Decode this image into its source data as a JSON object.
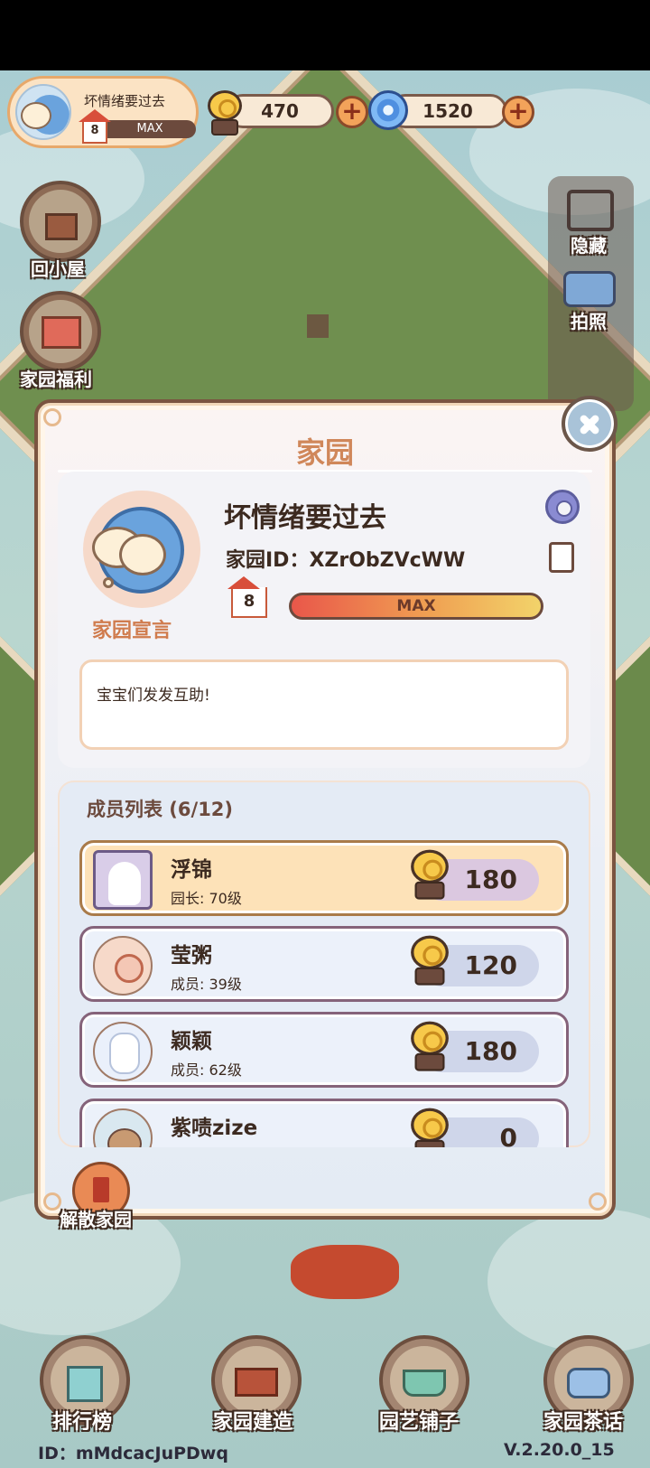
{
  "hud": {
    "garden_name": "坏情绪要过去",
    "level": "8",
    "level_state": "MAX",
    "snail_coins": "470",
    "orbs": "1520"
  },
  "side_left": [
    {
      "label": "回小屋"
    },
    {
      "label": "家园福利"
    }
  ],
  "side_right": [
    {
      "label": "隐藏"
    },
    {
      "label": "拍照"
    }
  ],
  "dialog": {
    "title": "家园",
    "garden_name": "坏情绪要过去",
    "garden_id": "家园ID：XZrObZVcWW",
    "level": "8",
    "level_state": "MAX",
    "declaration_label": "家园宣言",
    "declaration_text": "宝宝们发发互助!",
    "members_title": "成员列表 (6/12)",
    "members": [
      {
        "name": "浮锦",
        "role": "园长: 70级",
        "score": "180",
        "leader": true
      },
      {
        "name": "莹粥",
        "role": "成员: 39级",
        "score": "120",
        "leader": false
      },
      {
        "name": "颖颖",
        "role": "成员: 62级",
        "score": "180",
        "leader": false
      },
      {
        "name": "紫啧zize",
        "role": "",
        "score": "0",
        "leader": false
      }
    ],
    "disband_label": "解散家园"
  },
  "bottom_nav": [
    {
      "label": "排行榜"
    },
    {
      "label": "家园建造"
    },
    {
      "label": "园艺铺子"
    },
    {
      "label": "家园茶话"
    }
  ],
  "footer": {
    "user_id": "ID：mMdcacJuPDwq",
    "version": "V.2.20.0_15"
  },
  "colors": {
    "dialog_bg": "#fff6ea",
    "title": "#d0875a",
    "accent": "#f3a35a"
  }
}
